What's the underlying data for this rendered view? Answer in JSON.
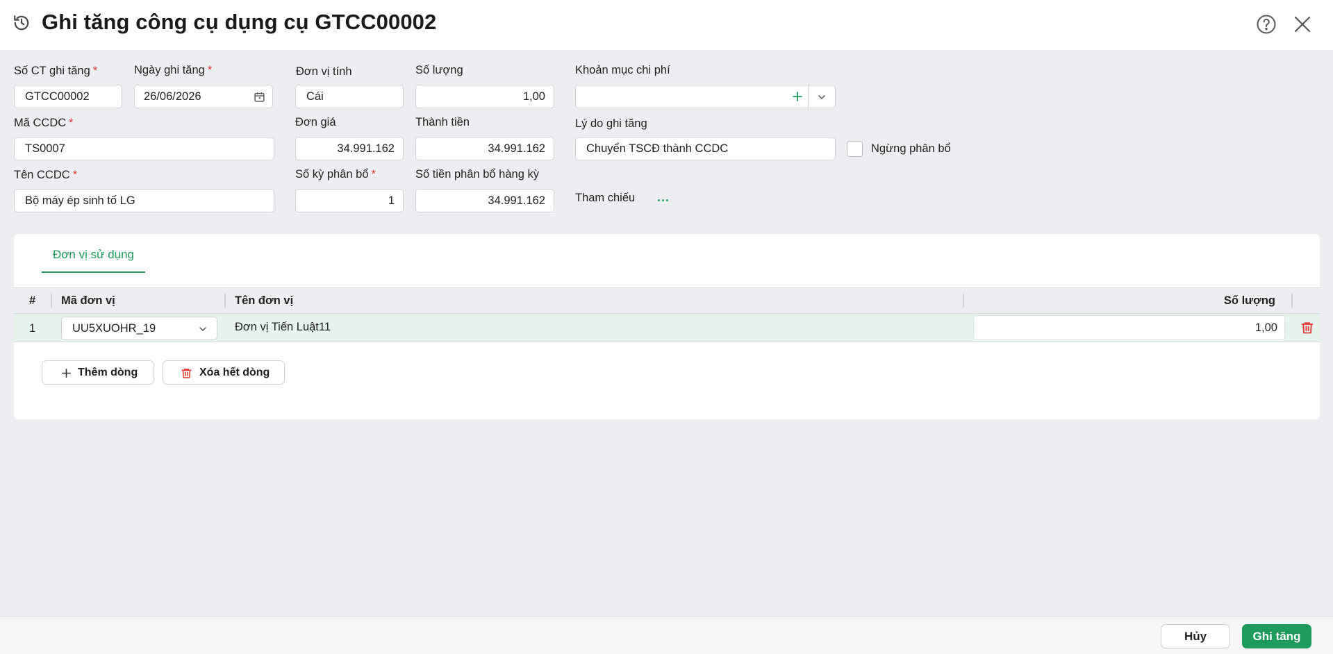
{
  "header": {
    "title": "Ghi tăng công cụ dụng cụ GTCC00002"
  },
  "form": {
    "so_ct": {
      "label": "Số CT ghi tăng",
      "value": "GTCC00002"
    },
    "ngay_ghi_tang": {
      "label": "Ngày ghi tăng",
      "value": "26/06/2026"
    },
    "don_vi_tinh": {
      "label": "Đơn vị tính",
      "value": "Cái"
    },
    "so_luong": {
      "label": "Số lượng",
      "value": "1,00"
    },
    "khoan_muc_chi_phi": {
      "label": "Khoản mục chi phí",
      "value": ""
    },
    "ma_ccdc": {
      "label": "Mã CCDC",
      "value": "TS0007"
    },
    "don_gia": {
      "label": "Đơn giá",
      "value": "34.991.162"
    },
    "thanh_tien": {
      "label": "Thành tiền",
      "value": "34.991.162"
    },
    "ly_do": {
      "label": "Lý do ghi tăng",
      "value": "Chuyển TSCĐ thành CCDC"
    },
    "ngung_phan_bo": {
      "label": "Ngừng phân bổ",
      "checked": false
    },
    "ten_ccdc": {
      "label": "Tên CCDC",
      "value": "Bộ máy ép sinh tố LG"
    },
    "so_ky_phan_bo": {
      "label": "Số kỳ phân bổ",
      "value": "1"
    },
    "so_tien_phan_bo": {
      "label": "Số tiền phân bổ hàng kỳ",
      "value": "34.991.162"
    },
    "tham_chieu": {
      "label": "Tham chiếu",
      "link": "..."
    },
    "required_mark": "*"
  },
  "panel": {
    "tab_label": "Đơn vị sử dụng",
    "columns": [
      "#",
      "Mã đơn vị",
      "Tên đơn vị",
      "Số lượng"
    ],
    "rows": [
      {
        "index": "1",
        "ma_don_vi": "UU5XUOHR_19",
        "ten_don_vi": "Đơn vị Tiến Luật11",
        "so_luong": "1,00"
      }
    ],
    "add_row_label": "Thêm dòng",
    "clear_rows_label": "Xóa hết dòng"
  },
  "footer": {
    "cancel_label": "Hủy",
    "submit_label": "Ghi tăng"
  },
  "colors": {
    "accent": "#1e9a5c",
    "danger": "#e53935",
    "background": "#eceef1"
  },
  "icons": [
    "history-icon",
    "help-icon",
    "close-icon",
    "calendar-icon",
    "plus-icon",
    "chevron-down-icon",
    "trash-icon"
  ]
}
